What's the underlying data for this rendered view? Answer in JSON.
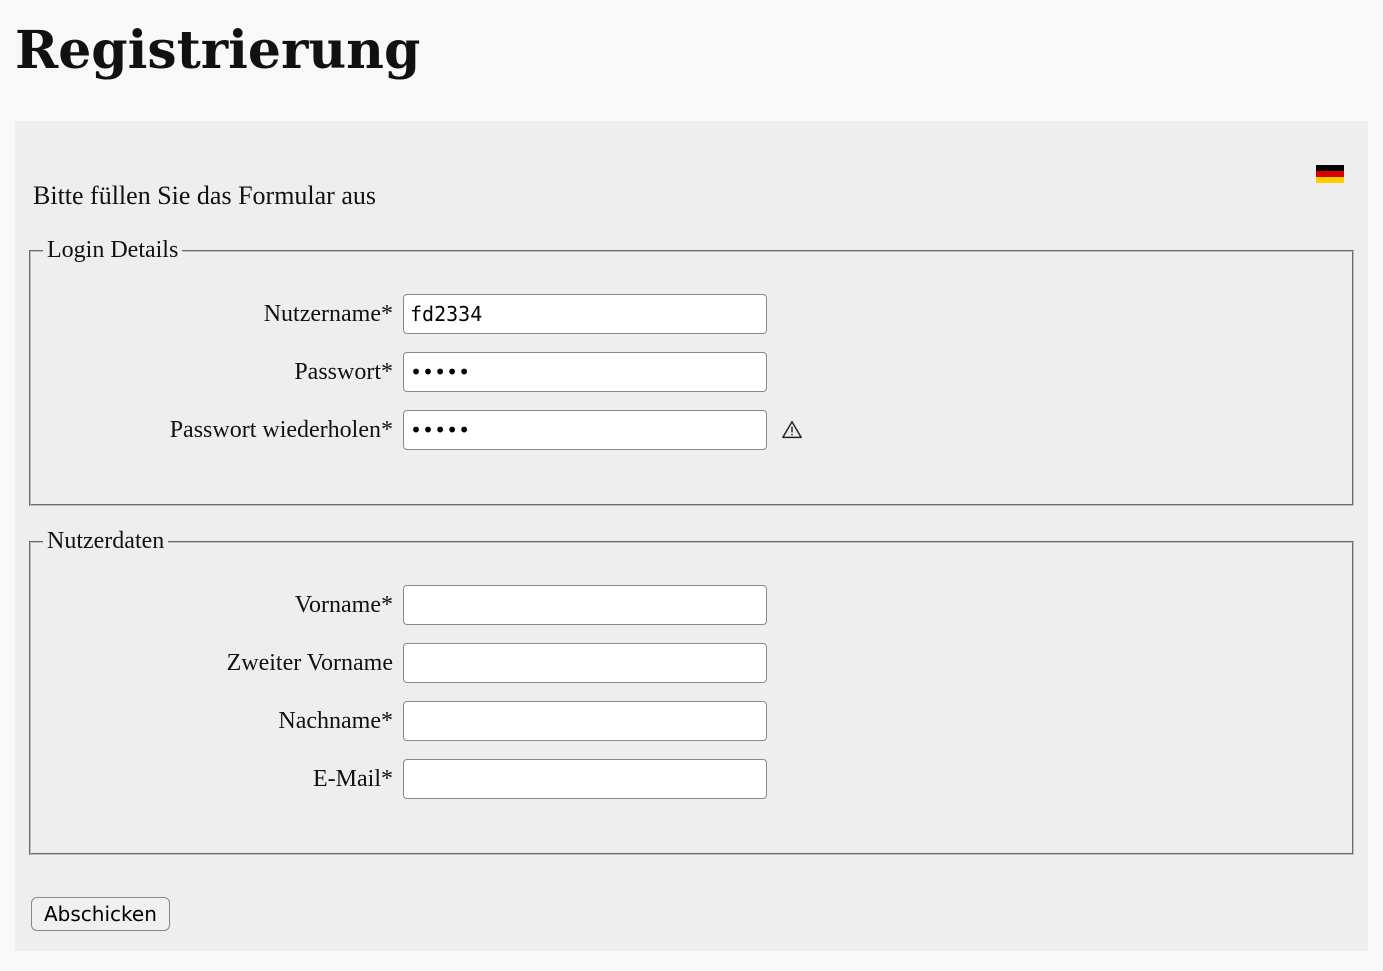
{
  "page_title": "Registrierung",
  "instructions": "Bitte füllen Sie das Formular aus",
  "flag": "germany-flag",
  "login_details": {
    "legend": "Login Details",
    "username_label": "Nutzername*",
    "username_value": "fd2334",
    "password_label": "Passwort*",
    "password_value": "•••••",
    "password_repeat_label": "Passwort wiederholen*",
    "password_repeat_value": "•••••",
    "warning_icon": "warning-icon"
  },
  "user_data": {
    "legend": "Nutzerdaten",
    "firstname_label": "Vorname*",
    "firstname_value": "",
    "middlename_label": "Zweiter Vorname",
    "middlename_value": "",
    "lastname_label": "Nachname*",
    "lastname_value": "",
    "email_label": "E-Mail*",
    "email_value": ""
  },
  "submit_label": "Abschicken"
}
